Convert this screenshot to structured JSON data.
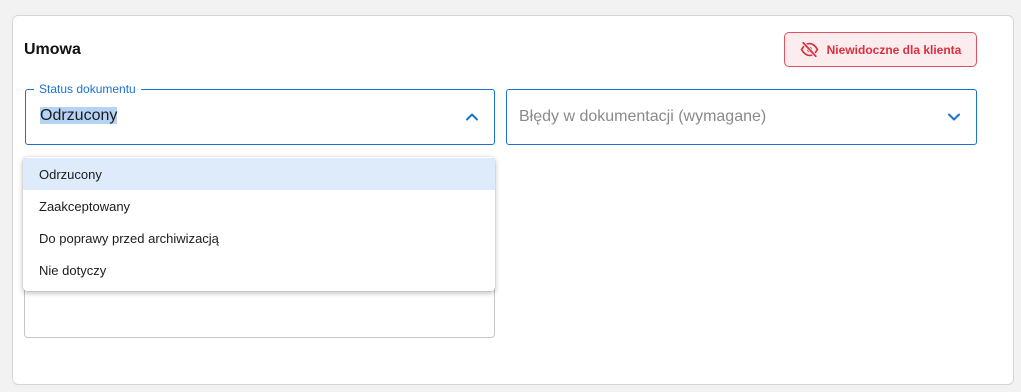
{
  "section": {
    "title": "Umowa"
  },
  "visibility_badge": {
    "label": "Niewidoczne dla klienta",
    "icon": "eye-off-icon",
    "color": "#d9303f"
  },
  "status_field": {
    "label": "Status dokumentu",
    "value": "Odrzucony",
    "options": [
      "Odrzucony",
      "Zaakceptowany",
      "Do poprawy przed archiwizacją",
      "Nie dotyczy"
    ],
    "highlighted_option": "Odrzucony",
    "expanded": true
  },
  "errors_field": {
    "placeholder": "Błędy w dokumentacji (wymagane)",
    "expanded": false
  },
  "colors": {
    "accent": "#1a73d2",
    "option_highlight": "#ddebfb"
  }
}
